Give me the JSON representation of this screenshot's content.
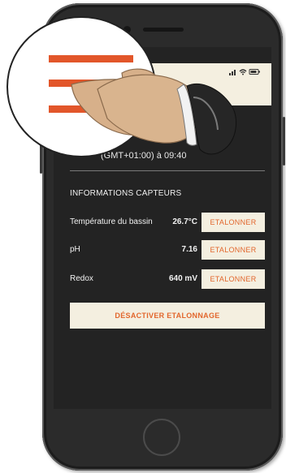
{
  "status_bar": {
    "icons": [
      "signal-icon",
      "wifi-icon",
      "battery-icon"
    ]
  },
  "schedule": {
    "text": "(GMT+01:00) à 09:40"
  },
  "sensors": {
    "title": "INFORMATIONS CAPTEURS",
    "rows": [
      {
        "label": "Température du bassin",
        "value": "26.7°C",
        "button": "ETALONNER"
      },
      {
        "label": "pH",
        "value": "7.16",
        "button": "ETALONNER"
      },
      {
        "label": "Redox",
        "value": "640 mV",
        "button": "ETALONNER"
      }
    ]
  },
  "actions": {
    "disable_calibration": "DÉSACTIVER ETALONNAGE"
  },
  "colors": {
    "accent": "#e2662c",
    "panel": "#f4efe0",
    "screen_bg": "#232323"
  },
  "overlay": {
    "icon": "hamburger-menu-icon",
    "pointer": "pointing-hand"
  }
}
